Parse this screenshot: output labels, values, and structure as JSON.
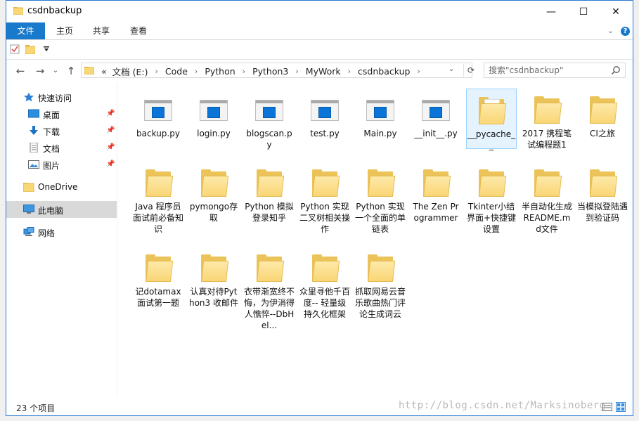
{
  "window": {
    "title": "csdnbackup",
    "minimize_glyph": "—",
    "maximize_glyph": "☐",
    "close_glyph": "✕"
  },
  "ribbon": {
    "tabs": [
      "文件",
      "主页",
      "共享",
      "查看"
    ],
    "expand_glyph": "⌄",
    "help_glyph": "?"
  },
  "address": {
    "breadcrumbs": [
      "«",
      "文档 (E:)",
      "Code",
      "Python",
      "Python3",
      "MyWork",
      "csdnbackup"
    ],
    "separator": "›",
    "dropdown_glyph": "⌄",
    "refresh_glyph": "⟳"
  },
  "search": {
    "placeholder": "搜索\"csdnbackup\""
  },
  "nav_buttons": {
    "back": "←",
    "forward": "→",
    "recent": "⌄",
    "up": "↑"
  },
  "sidebar": {
    "quick_access": "快速访问",
    "pinned": [
      "桌面",
      "下载",
      "文档",
      "图片"
    ],
    "onedrive": "OneDrive",
    "this_pc": "此电脑",
    "network": "网络"
  },
  "files": [
    {
      "name": "backup.py",
      "type": "py"
    },
    {
      "name": "login.py",
      "type": "py"
    },
    {
      "name": "blogscan.py",
      "type": "py"
    },
    {
      "name": "test.py",
      "type": "py"
    },
    {
      "name": "Main.py",
      "type": "py"
    },
    {
      "name": "__init__.py",
      "type": "py"
    },
    {
      "name": "__pycache__",
      "type": "folder"
    },
    {
      "name": "2017 携程笔试编程题1",
      "type": "folder"
    },
    {
      "name": "CI之旅",
      "type": "folder"
    },
    {
      "name": "Java 程序员 面试前必备知识",
      "type": "folder"
    },
    {
      "name": "pymongo存取",
      "type": "folder"
    },
    {
      "name": "Python 模拟登录知乎",
      "type": "folder"
    },
    {
      "name": "Python 实现二叉树相关操作",
      "type": "folder"
    },
    {
      "name": "Python 实现一个全面的单链表",
      "type": "folder"
    },
    {
      "name": "The Zen Programmer",
      "type": "folder"
    },
    {
      "name": "Tkinter小结 界面+快捷键设置",
      "type": "folder"
    },
    {
      "name": "半自动化生成README.md文件",
      "type": "folder"
    },
    {
      "name": "当模拟登陆遇到验证码",
      "type": "folder"
    },
    {
      "name": "记dotamax面试第一题",
      "type": "folder"
    },
    {
      "name": "认真对待Python3 收邮件",
      "type": "folder"
    },
    {
      "name": "衣带渐宽终不悔，为伊消得人憔悴--DbHel...",
      "type": "folder"
    },
    {
      "name": "众里寻他千百度-- 轻量级持久化框架",
      "type": "folder"
    },
    {
      "name": "抓取网易云音乐歌曲热门评论生成词云",
      "type": "folder"
    }
  ],
  "status": {
    "item_count": "23 个项目"
  },
  "watermark": "http://blog.csdn.net/Marksinoberg"
}
